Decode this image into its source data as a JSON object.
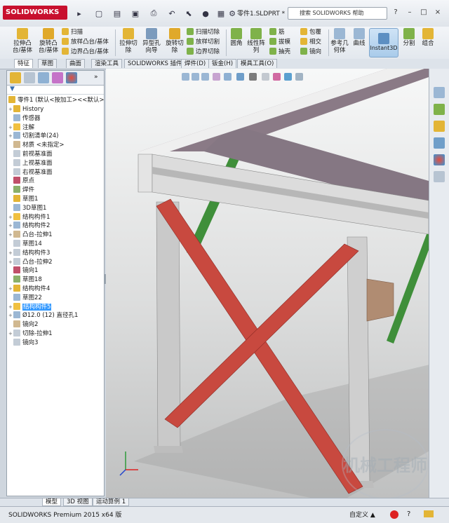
{
  "titlebar": {
    "logo": "SOLIDWORKS",
    "document_name": "零件1.SLDPRT *",
    "search_placeholder": "搜索 SOLIDWORKS 帮助",
    "window_controls": [
      "?",
      "–",
      "□",
      "×"
    ]
  },
  "ribbon": {
    "extrude_boss": "拉伸凸台/基体",
    "revolve_boss": "旋转凸台/基体",
    "sweep": "扫描",
    "loft_boss": "放样凸台/基体",
    "boundary_boss": "边界凸台/基体",
    "extrude_cut": "拉伸切除",
    "hole_wizard": "异型孔向导",
    "revolve_cut": "旋转切除",
    "swept_cut": "扫描切除",
    "lofted_cut": "放样切割",
    "boundary_cut": "边界切除",
    "fillet": "圆角",
    "linear_pattern": "线性阵列",
    "rib": "筋",
    "draft": "拔模",
    "shell": "抽壳",
    "wrap": "包覆",
    "intersect": "相交",
    "mirror": "镜向",
    "ref_geometry": "参考几何体",
    "curves": "曲线",
    "instant3d": "Instant3D",
    "split": "分割",
    "combine": "组合"
  },
  "command_tabs": [
    "特征",
    "草图",
    "曲面",
    "渲染工具",
    "SOLIDWORKS 插件",
    "焊件(D)",
    "钣金(H)",
    "模具工具(O)"
  ],
  "feature_tree": {
    "root": "零件1 (默认<按加工><<默认>",
    "items": [
      {
        "label": "History",
        "expand": "+"
      },
      {
        "label": "传感器",
        "expand": ""
      },
      {
        "label": "注解",
        "expand": "+"
      },
      {
        "label": "切割清单(24)",
        "expand": "+"
      },
      {
        "label": "材质 <未指定>",
        "expand": ""
      },
      {
        "label": "前视基准面",
        "expand": ""
      },
      {
        "label": "上视基准面",
        "expand": ""
      },
      {
        "label": "右视基准面",
        "expand": ""
      },
      {
        "label": "原点",
        "expand": ""
      },
      {
        "label": "焊件",
        "expand": ""
      },
      {
        "label": "草图1",
        "expand": ""
      },
      {
        "label": "3D草图1",
        "expand": ""
      },
      {
        "label": "结构构件1",
        "expand": "+"
      },
      {
        "label": "结构构件2",
        "expand": "+"
      },
      {
        "label": "凸台-拉伸1",
        "expand": "+"
      },
      {
        "label": "草图14",
        "expand": ""
      },
      {
        "label": "结构构件3",
        "expand": "+"
      },
      {
        "label": "凸台-拉伸2",
        "expand": "+"
      },
      {
        "label": "镜向1",
        "expand": ""
      },
      {
        "label": "草图18",
        "expand": ""
      },
      {
        "label": "结构构件4",
        "expand": "+"
      },
      {
        "label": "草图22",
        "expand": ""
      },
      {
        "label": "结构构件5",
        "expand": "+",
        "selected": true
      },
      {
        "label": "Ø12.0 (12) 直径孔1",
        "expand": "+"
      },
      {
        "label": "镜向2",
        "expand": ""
      },
      {
        "label": "切除-拉伸1",
        "expand": "+"
      },
      {
        "label": "镜向3",
        "expand": ""
      }
    ]
  },
  "bottom_tabs": [
    "模型",
    "3D 视图",
    "运动算例 1"
  ],
  "statusbar": {
    "text": "SOLIDWORKS Premium 2015 x64 版",
    "right": "自定义 ▲"
  },
  "watermark": "机械工程师",
  "colors": {
    "red_brace": "#c8493f",
    "green_brace": "#3f8f3a",
    "beam_top": "#8a7a86",
    "column": "#c9c9c9",
    "selection": "#3399ff"
  }
}
